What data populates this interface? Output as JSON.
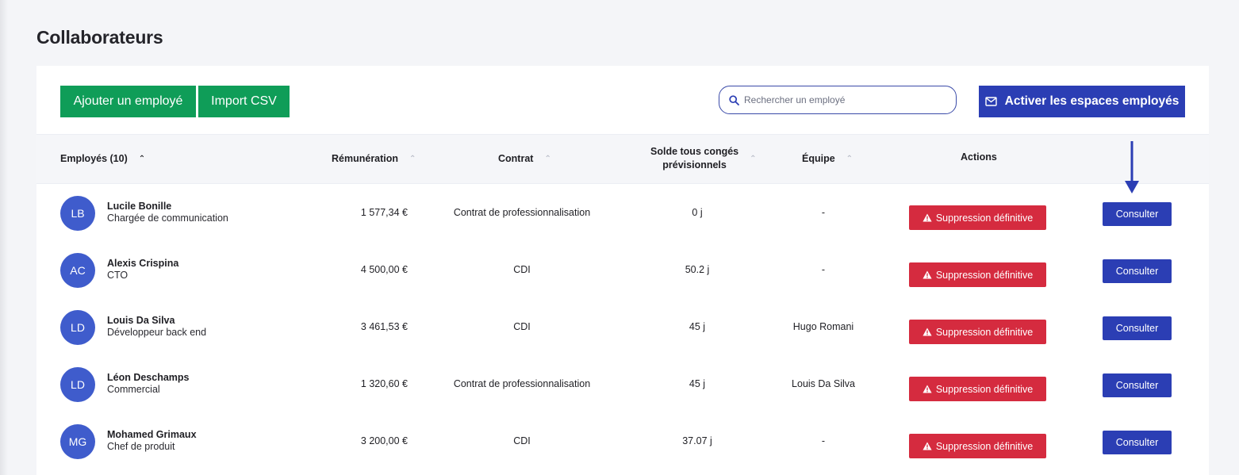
{
  "page": {
    "title": "Collaborateurs"
  },
  "toolbar": {
    "add_label": "Ajouter un employé",
    "import_label": "Import CSV",
    "search_placeholder": "Rechercher un employé",
    "activate_label": "Activer les espaces employés"
  },
  "table": {
    "headers": {
      "employees": "Employés (10)",
      "salary": "Rémunération",
      "contract": "Contrat",
      "balance_line1": "Solde tous congés",
      "balance_line2": "prévisionnels",
      "team": "Équipe",
      "actions": "Actions"
    },
    "delete_label": "Suppression définitive",
    "consult_label": "Consulter",
    "rows": [
      {
        "initials": "LB",
        "name": "Lucile Bonille",
        "role": "Chargée de communication",
        "salary": "1 577,34 €",
        "contract": "Contrat de professionnalisation",
        "balance": "0 j",
        "team": "-"
      },
      {
        "initials": "AC",
        "name": "Alexis Crispina",
        "role": "CTO",
        "salary": "4 500,00 €",
        "contract": "CDI",
        "balance": "50.2 j",
        "team": "-"
      },
      {
        "initials": "LD",
        "name": "Louis Da Silva",
        "role": "Développeur back end",
        "salary": "3 461,53 €",
        "contract": "CDI",
        "balance": "45 j",
        "team": "Hugo Romani"
      },
      {
        "initials": "LD",
        "name": "Léon Deschamps",
        "role": "Commercial",
        "salary": "1 320,60 €",
        "contract": "Contrat de professionnalisation",
        "balance": "45 j",
        "team": "Louis Da Silva"
      },
      {
        "initials": "MG",
        "name": "Mohamed Grimaux",
        "role": "Chef de produit",
        "salary": "3 200,00 €",
        "contract": "CDI",
        "balance": "37.07 j",
        "team": "-"
      }
    ]
  },
  "colors": {
    "green": "#0f9d58",
    "blue": "#2b3eb4",
    "red": "#d52b3f",
    "avatar": "#3f5ccc"
  },
  "icons": {
    "search": "search-icon",
    "mail": "mail-icon",
    "warning": "warning-icon",
    "arrow": "arrow-down-icon",
    "sort": "chevron-up-icon"
  }
}
